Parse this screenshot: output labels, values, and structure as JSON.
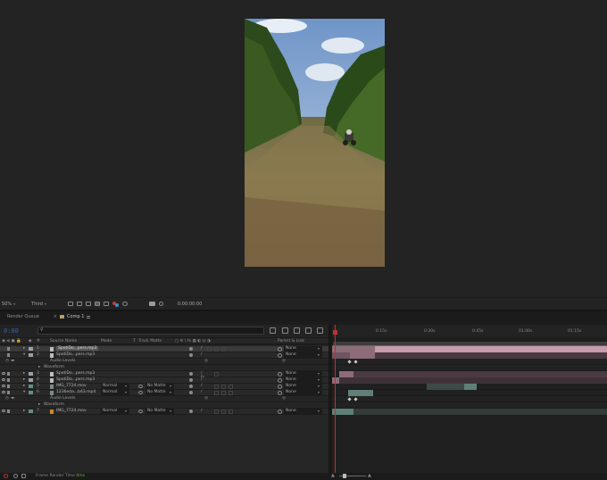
{
  "viewer_toolbar": {
    "magnification": "50%",
    "resolution": "Third",
    "timecode": "0:00:00:00"
  },
  "tabs": {
    "render_queue": "Render Queue",
    "comp": "Comp 1"
  },
  "timeline": {
    "current_time": "0:00",
    "ruler": [
      "0:15s",
      "0:30s",
      "0:45s",
      "01:00s",
      "01:15s"
    ]
  },
  "columns": {
    "source_name": "Source Name",
    "mode": "Mode",
    "t": "T",
    "track_matte": "Track Matte",
    "parent_link": "Parent & Link"
  },
  "layers": [
    {
      "num": "1",
      "name": "SpotiDo...pers.mp3",
      "type": "audio",
      "label_color": "#9aa0a6",
      "parent": "None",
      "selected": true
    },
    {
      "num": "2",
      "name": "SpotiDo...pers.mp3",
      "type": "audio",
      "label_color": "#9aa0a6",
      "parent": "None"
    },
    {
      "sub": "Audio Levels"
    },
    {
      "sub": "Waveform",
      "group": true
    },
    {
      "num": "3",
      "name": "SpotiDo...pers.mp3",
      "type": "audio",
      "label_color": "#9aa0a6",
      "parent": "None"
    },
    {
      "num": "4",
      "name": "SpotiDo...pers.mp3",
      "type": "audio",
      "label_color": "#9aa0a6",
      "parent": "None"
    },
    {
      "num": "5",
      "name": "IMG_7724.mov",
      "type": "video",
      "label_color": "#5f8f88",
      "mode": "Normal",
      "matte": "No Matte",
      "parent": "None"
    },
    {
      "num": "6",
      "name": "1236eda...b43.mp4",
      "type": "video",
      "label_color": "#5f8f88",
      "mode": "Normal",
      "matte": "No Matte",
      "parent": "None"
    },
    {
      "sub": "Audio Levels"
    },
    {
      "sub": "Waveform",
      "group": true
    },
    {
      "num": "7",
      "name": "IMG_7724.mov",
      "type": "video-orange",
      "label_color": "#5f8f88",
      "mode": "Normal",
      "matte": "No Matte",
      "parent": "None"
    }
  ],
  "footer": {
    "frame_render_label": "Frame Render Time",
    "frame_render_value": "0ms"
  },
  "colors": {
    "timecode": "#3b5fa8",
    "cti": "#c13030",
    "audio_bar": "#8e6b78",
    "audio_bar_pink": "#c99aae",
    "video_bar": "#5f7f79",
    "green_line": "#2f8a3a"
  }
}
